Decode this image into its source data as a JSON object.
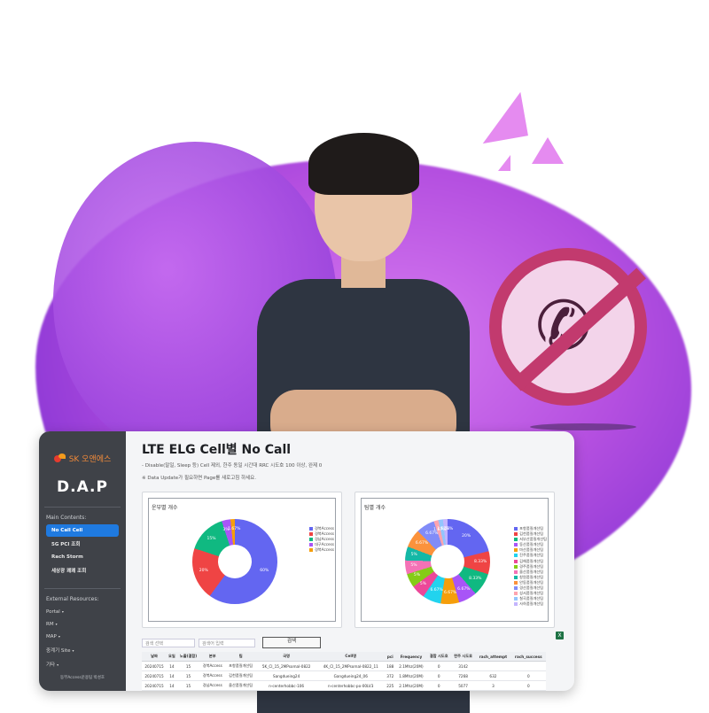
{
  "app": {
    "logo_text": "SK 오앤에스",
    "name": "D.A.P",
    "colors": {
      "accent": "#1f7ae0",
      "sidebar": "#3f4248",
      "brand_red": "#e53b2e",
      "brand_orange": "#f39b1d"
    }
  },
  "sidebar": {
    "main_heading": "Main Contents:",
    "items": [
      {
        "label": "No Call Cell",
        "active": true
      },
      {
        "label": "5G PCI 조회",
        "active": false
      },
      {
        "label": "Rach Storm",
        "active": false
      },
      {
        "label": "세상광 쾌쾌 조회",
        "active": false
      }
    ],
    "external_heading": "External Resources:",
    "external": [
      {
        "label": "Portal",
        "icon": "chevron-down-icon"
      },
      {
        "label": "RM",
        "icon": "chevron-down-icon"
      },
      {
        "label": "MAP",
        "icon": "chevron-down-icon"
      },
      {
        "label": "중계기 Site",
        "icon": "chevron-down-icon"
      },
      {
        "label": "기타",
        "icon": "chevron-down-icon"
      }
    ],
    "footer": "동부Access운용팀 박성호"
  },
  "page": {
    "title": "LTE ELG Cell별 No Call",
    "subtitle": "- Disable(말일, Sleep 등) Cell 제외, 한주 동일 시간대 RRC 시도호 100 이상, 완제 0",
    "note": "※ Data Update가 필요하면 Page를 새로고침 하세요.",
    "search_placeholder_1": "검색 선택",
    "search_placeholder_2": "검색어 입력",
    "search_button": "검색",
    "excel_icon": "excel-icon"
  },
  "chart_data": [
    {
      "type": "pie",
      "title": "운부별 개수",
      "labels": [
        "경북Access",
        "경북Access",
        "경남Access",
        "대구Access",
        "경북Access"
      ],
      "colors": [
        "#6366f1",
        "#ef4444",
        "#10b981",
        "#a855f7",
        "#f59e0b"
      ],
      "values": [
        60,
        20,
        15,
        3.33,
        1.67
      ],
      "value_labels": [
        "60%",
        "20%",
        "15%",
        "3%",
        "1.67%"
      ]
    },
    {
      "type": "pie",
      "title": "팀별 개수",
      "labels": [
        "포항품질개선팀",
        "김천품질개선팀",
        "서부산품질개선팀",
        "동산품질개선팀",
        "마산품질개선팀",
        "진주품질개선팀",
        "김해품질개선팀",
        "경주품질개선팀",
        "울산품질개선팀",
        "창원품질개선팀",
        "안동품질개선팀",
        "경산품질개선팀",
        "성서품질개선팀",
        "칠곡품질개선팀",
        "사하품질개선팀"
      ],
      "colors": [
        "#6366f1",
        "#ef4444",
        "#10b981",
        "#a855f7",
        "#f59e0b",
        "#22d3ee",
        "#ec4899",
        "#84cc16",
        "#f472b6",
        "#14b8a6",
        "#fb923c",
        "#818cf8",
        "#fda4af",
        "#93c5fd",
        "#c4b5fd"
      ],
      "values": [
        20,
        8.33,
        8.33,
        6.67,
        6.67,
        6.67,
        5,
        5,
        5,
        5,
        6.67,
        6.67,
        1.67,
        1.67,
        1.67
      ],
      "value_labels": [
        "20%",
        "8.33%",
        "8.33%",
        "6.67%",
        "6.67%",
        "6.67%",
        "5%",
        "5%",
        "5%",
        "5%",
        "6.67%",
        "6.67%",
        "1.67%",
        "1.67%",
        "1.67%"
      ]
    }
  ],
  "table": {
    "headers": [
      "날짜",
      "요일",
      "노출(결합)",
      "본부",
      "팀",
      "국명",
      "Cell명",
      "pci",
      "Frequency",
      "결합 시도호",
      "한주 시도호",
      "rach_attempt",
      "rach_success"
    ],
    "rows": [
      [
        "20240715",
        "14",
        "15",
        "경북Access",
        "포항품질개선팀",
        "5K_CI_15_2MPsomal-0822",
        "4K_CI_15_2MPsomal-0822_11",
        "188",
        "2.1Mhz(20M)",
        "0",
        "3142",
        "",
        ""
      ],
      [
        "20240715",
        "14",
        "15",
        "경북Access",
        "김천품질개선팀",
        "Sangdueing24",
        "Gangdueing24_06",
        "372",
        "1.8Mhz(20M)",
        "0",
        "7268",
        "632",
        "0"
      ],
      [
        "20240715",
        "14",
        "15",
        "경남Access",
        "울산품질개선팀",
        "n-centerhobbc-106",
        "n-centerhobbc-po-00LV3",
        "225",
        "2.1Mhz(20M)",
        "0",
        "5077",
        "3",
        "0"
      ],
      [
        "20240715",
        "14",
        "11",
        "경남Access",
        "울산품질개선팀",
        "n-toni-center-6670",
        "n-toni-center-6670_11",
        "225",
        "2.1Mhz(20M)",
        "0",
        "5519",
        "3",
        "0"
      ]
    ]
  }
}
